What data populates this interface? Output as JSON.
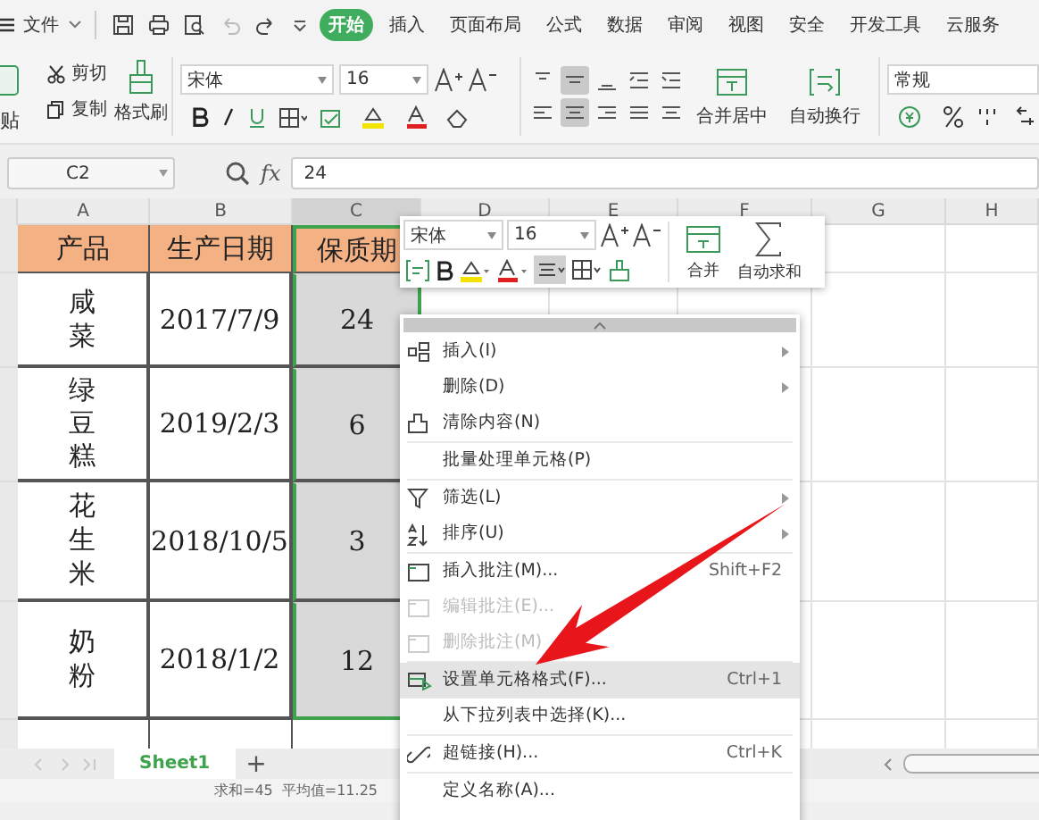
{
  "menu_bar": {
    "file_label": "文件",
    "tabs": [
      {
        "label": "开始",
        "selected": true
      },
      {
        "label": "插入",
        "selected": false
      },
      {
        "label": "页面布局",
        "selected": false
      },
      {
        "label": "公式",
        "selected": false
      },
      {
        "label": "数据",
        "selected": false
      },
      {
        "label": "审阅",
        "selected": false
      },
      {
        "label": "视图",
        "selected": false
      },
      {
        "label": "安全",
        "selected": false
      },
      {
        "label": "开发工具",
        "selected": false
      },
      {
        "label": "云服务",
        "selected": false
      }
    ]
  },
  "ribbon": {
    "paste_label": "贴",
    "cut_label": "剪切",
    "copy_label": "复制",
    "format_painter_label": "格式刷",
    "font": "宋体",
    "font_size": "16",
    "merge_label": "合并居中",
    "wrap_label": "自动换行",
    "number_format": "常规"
  },
  "formula_bar": {
    "cell_ref": "C2",
    "fx_label": "fx",
    "value": "24"
  },
  "columns": [
    {
      "label": "A",
      "selected": false
    },
    {
      "label": "B",
      "selected": false
    },
    {
      "label": "C",
      "selected": true
    },
    {
      "label": "D",
      "selected": false
    },
    {
      "label": "E",
      "selected": false
    },
    {
      "label": "F",
      "selected": false
    },
    {
      "label": "G",
      "selected": false
    },
    {
      "label": "H",
      "selected": false
    }
  ],
  "table": {
    "rows": [
      {
        "kind": "header",
        "cells": [
          {
            "text": "产品",
            "selected": false
          },
          {
            "text": "生产日期",
            "selected": false
          },
          {
            "text": "保质期",
            "selected": true
          }
        ]
      },
      {
        "kind": "data",
        "cells": [
          {
            "text": "咸菜",
            "selected": false
          },
          {
            "text": "2017/7/9",
            "selected": false
          },
          {
            "text": "24",
            "selected": true
          }
        ]
      },
      {
        "kind": "data",
        "cells": [
          {
            "text": "绿豆糕",
            "selected": false
          },
          {
            "text": "2019/2/3",
            "selected": false
          },
          {
            "text": "6",
            "selected": true
          }
        ]
      },
      {
        "kind": "data",
        "cells": [
          {
            "text": "花生米",
            "selected": false
          },
          {
            "text": "2018/10/5",
            "selected": false
          },
          {
            "text": "3",
            "selected": true
          }
        ]
      },
      {
        "kind": "data",
        "cells": [
          {
            "text": "奶粉",
            "selected": false
          },
          {
            "text": "2018/1/2",
            "selected": false
          },
          {
            "text": "12",
            "selected": true
          }
        ]
      }
    ]
  },
  "mini_toolbar": {
    "font": "宋体",
    "font_size": "16",
    "merge_label": "合并",
    "autosum_label": "自动求和"
  },
  "context_menu": {
    "sections": [
      [
        {
          "label": "插入(I)",
          "submenu": true,
          "disabled": false,
          "selected": false
        },
        {
          "label": "删除(D)",
          "submenu": true,
          "disabled": false,
          "selected": false
        },
        {
          "label": "清除内容(N)",
          "submenu": false,
          "disabled": false,
          "selected": false
        }
      ],
      [
        {
          "label": "批量处理单元格(P)",
          "submenu": false,
          "disabled": false,
          "selected": false
        }
      ],
      [
        {
          "label": "筛选(L)",
          "submenu": true,
          "disabled": false,
          "selected": false
        },
        {
          "label": "排序(U)",
          "submenu": true,
          "disabled": false,
          "selected": false
        }
      ],
      [
        {
          "label": "插入批注(M)...",
          "shortcut": "Shift+F2",
          "submenu": false,
          "disabled": false,
          "selected": false
        },
        {
          "label": "编辑批注(E)...",
          "submenu": false,
          "disabled": true,
          "selected": false
        },
        {
          "label": "删除批注(M)",
          "submenu": false,
          "disabled": true,
          "selected": false
        }
      ],
      [
        {
          "label": "设置单元格格式(F)...",
          "shortcut": "Ctrl+1",
          "submenu": false,
          "disabled": false,
          "selected": true
        },
        {
          "label": "从下拉列表中选择(K)...",
          "submenu": false,
          "disabled": false,
          "selected": false
        }
      ],
      [
        {
          "label": "超链接(H)...",
          "shortcut": "Ctrl+K",
          "submenu": false,
          "disabled": false,
          "selected": false
        }
      ],
      [
        {
          "label": "定义名称(A)...",
          "submenu": false,
          "disabled": false,
          "selected": false
        }
      ]
    ]
  },
  "sheet_tabs": {
    "tabs": [
      {
        "label": "Sheet1",
        "selected": true
      }
    ],
    "add_label": "+"
  },
  "status_bar": {
    "sum": "求和=45",
    "average": "平均值=11.25"
  }
}
